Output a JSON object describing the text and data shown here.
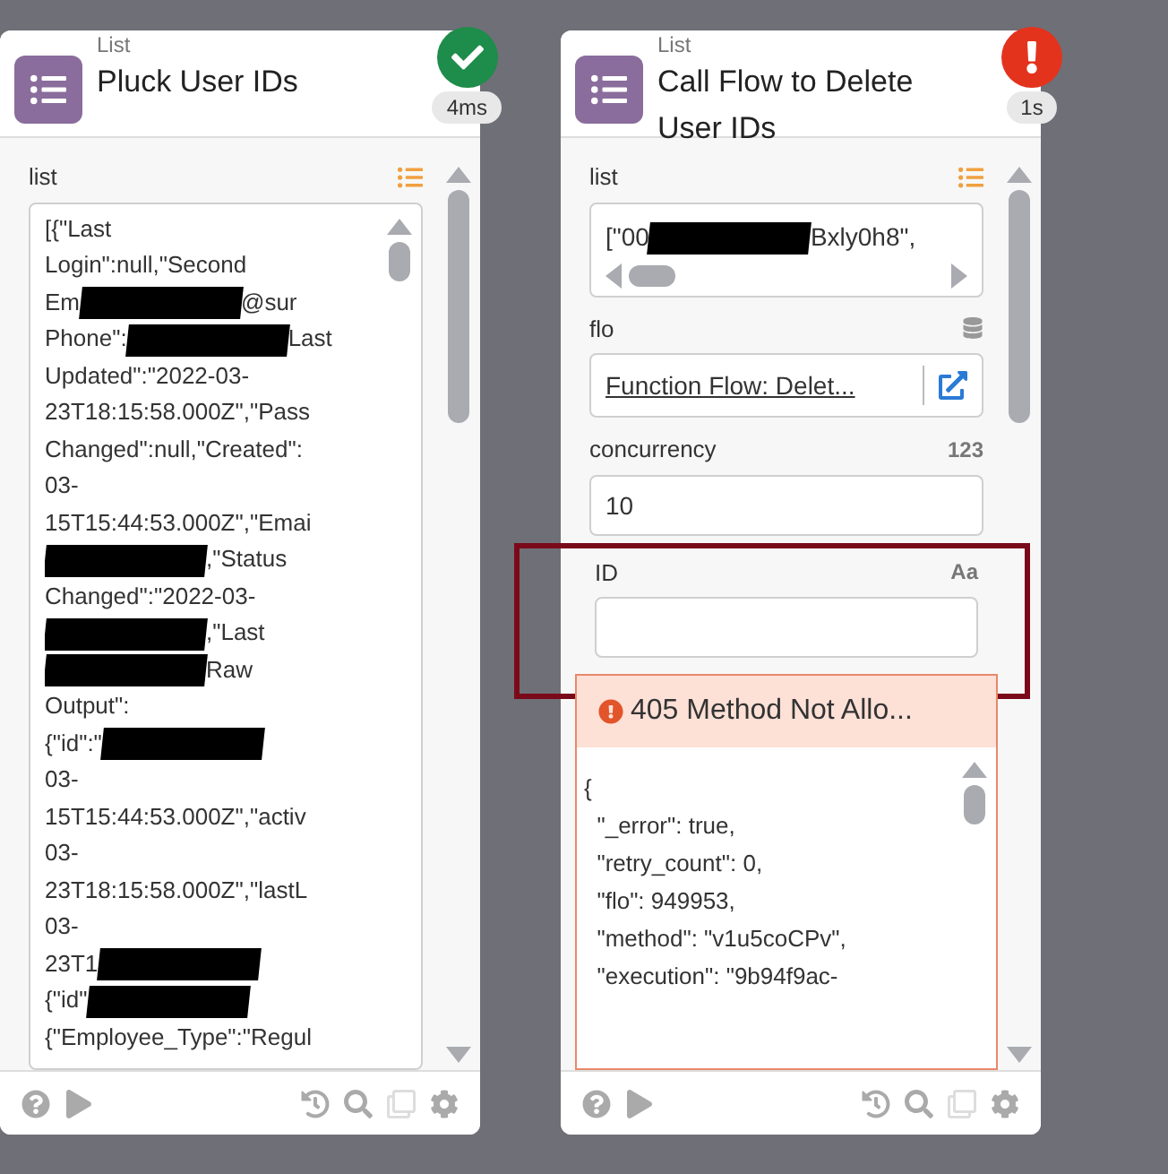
{
  "cards": [
    {
      "category": "List",
      "title": "Pluck User IDs",
      "badge": {
        "kind": "success",
        "time": "4ms"
      },
      "fields": [
        {
          "kind": "textarea",
          "label": "list",
          "lines": [
            [
              {
                "text": "[{\"Last"
              }
            ],
            [
              {
                "text": "Login\":null,\"Second"
              }
            ],
            [
              {
                "text": "Em"
              },
              {
                "kind": "redaction"
              },
              {
                "text": "@sur"
              }
            ],
            [
              {
                "text": "Phone\":"
              },
              {
                "kind": "redaction"
              },
              {
                "text": "Last"
              }
            ],
            [
              {
                "text": "Updated\":\"2022-03-"
              }
            ],
            [
              {
                "text": "23T18:15:58.000Z\",\"Pass"
              }
            ],
            [
              {
                "text": "Changed\":null,\"Created\":"
              }
            ],
            [
              {
                "text": "03-"
              }
            ],
            [
              {
                "text": "15T15:44:53.000Z\",\"Emai"
              }
            ],
            [
              {
                "kind": "redaction"
              },
              {
                "text": ",\"Status"
              }
            ],
            [
              {
                "text": "Changed\":\"2022-03-"
              }
            ],
            [
              {
                "kind": "redaction"
              },
              {
                "text": ",\"Last"
              }
            ],
            [
              {
                "kind": "redaction"
              },
              {
                "text": "Raw"
              }
            ],
            [
              {
                "text": "Output\":"
              }
            ],
            [
              {
                "text": "{\"id\":\""
              },
              {
                "kind": "redaction"
              }
            ],
            [
              {
                "text": "03-"
              }
            ],
            [
              {
                "text": "15T15:44:53.000Z\",\"activ"
              }
            ],
            [
              {
                "text": "03-"
              }
            ],
            [
              {
                "text": "23T18:15:58.000Z\",\"lastL"
              }
            ],
            [
              {
                "text": "03-"
              }
            ],
            [
              {
                "text": "23T1"
              },
              {
                "kind": "redaction"
              }
            ],
            [
              {
                "text": "{\"id\""
              },
              {
                "kind": "redaction"
              }
            ],
            [
              {
                "text": "{\"Employee_Type\":\"Regul"
              }
            ]
          ]
        }
      ]
    },
    {
      "category": "List",
      "title": "Call Flow to Delete User IDs",
      "badge": {
        "kind": "error",
        "time": "1s"
      },
      "fields": [
        {
          "kind": "hscroll",
          "label": "list",
          "segments": [
            {
              "text": "[\"00"
            },
            {
              "kind": "redaction"
            },
            {
              "text": "Bxly0h8\","
            }
          ]
        },
        {
          "kind": "link",
          "label": "flo",
          "value": "Function Flow: Delet..."
        },
        {
          "kind": "input",
          "label": "concurrency",
          "type_hint": "123",
          "value": "10",
          "highlighted": false
        },
        {
          "kind": "input",
          "label": "ID",
          "type_hint": "Aa",
          "highlighted": true
        },
        {
          "kind": "error",
          "title": "405 Method Not Allo...",
          "lines": [
            "{",
            "  \"_error\": true,",
            "  \"retry_count\": 0,",
            "  \"flo\": 949953,",
            "  \"method\": \"v1u5coCPv\",",
            "  \"execution\": \"9b94f9ac-"
          ]
        }
      ]
    }
  ]
}
